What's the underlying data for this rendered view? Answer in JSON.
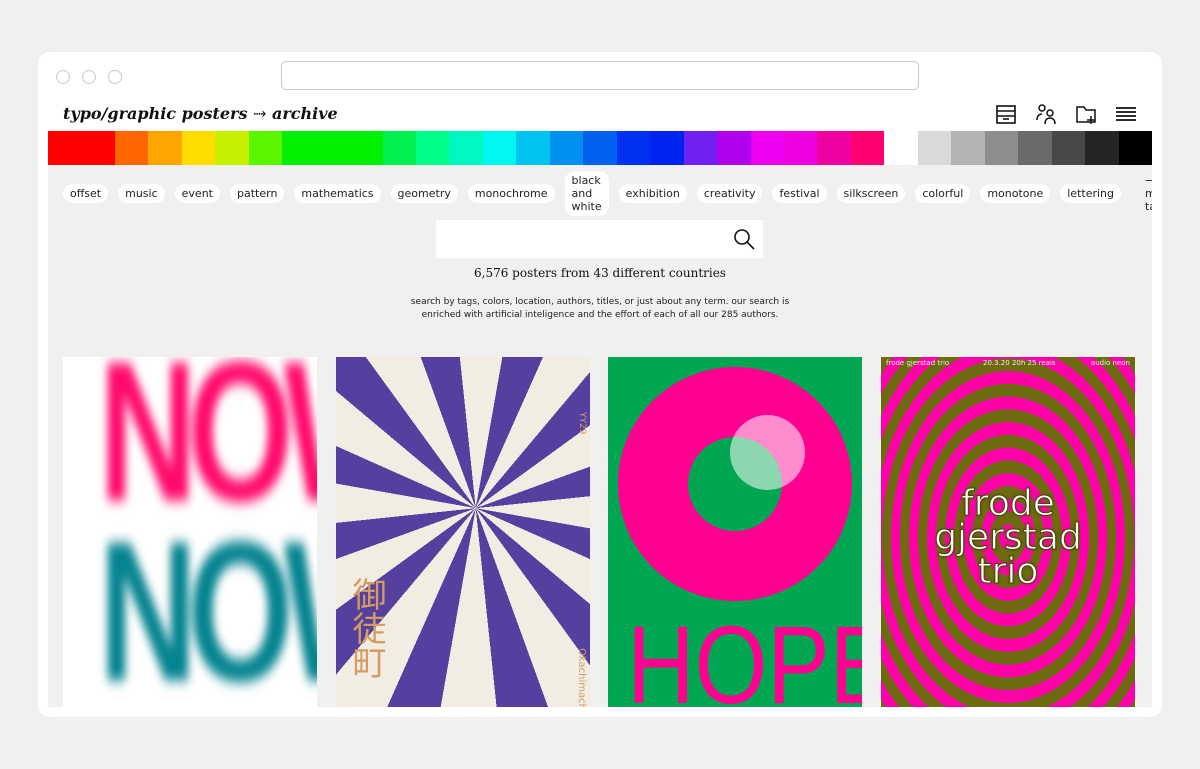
{
  "header": {
    "logo": "typo/graphic posters ⤑ archive",
    "icons": [
      "archive-box-icon",
      "users-icon",
      "folder-add-icon",
      "menu-icon"
    ]
  },
  "colors": [
    "#ff0000",
    "#ff0000",
    "#ff6600",
    "#ffa500",
    "#ffdd00",
    "#c5f000",
    "#5cf500",
    "#00f000",
    "#00f000",
    "#00f000",
    "#00f050",
    "#00ff88",
    "#00f8c0",
    "#00f8f0",
    "#00c4f0",
    "#0090f0",
    "#0060f0",
    "#0030f0",
    "#0024f0",
    "#7020f0",
    "#b000f0",
    "#f000f0",
    "#f000e0",
    "#f000a0",
    "#ff0070",
    "#ffffff",
    "#d9d9d9",
    "#b3b3b3",
    "#8e8e8e",
    "#6a6a6a",
    "#484848",
    "#242424",
    "#000000"
  ],
  "tags": [
    "offset",
    "music",
    "event",
    "pattern",
    "mathematics",
    "geometry",
    "monochrome",
    "black and white",
    "exhibition",
    "creativity",
    "festival",
    "silkscreen",
    "colorful",
    "monotone",
    "lettering"
  ],
  "more_tags": "⟶ more tags",
  "search": {
    "placeholder": "",
    "value": ""
  },
  "count": "6,576 posters from 43 different countries",
  "description_1": "search by tags, colors, location, authors, titles, or just about any term. our search is",
  "description_2": "enriched with artificial inteligence and the effort of each of all our 285 authors.",
  "posters": [
    {
      "text": "NOW"
    },
    {
      "text": "御徒町",
      "side": "YY29",
      "bottom": "Okachimachi"
    },
    {
      "text": "HOPE"
    },
    {
      "top_left": "frode gjerstad trio",
      "top_mid": "20.3.20 20h 25 reais",
      "top_right": "audio neon",
      "text": "frode gjerstad trio"
    }
  ]
}
